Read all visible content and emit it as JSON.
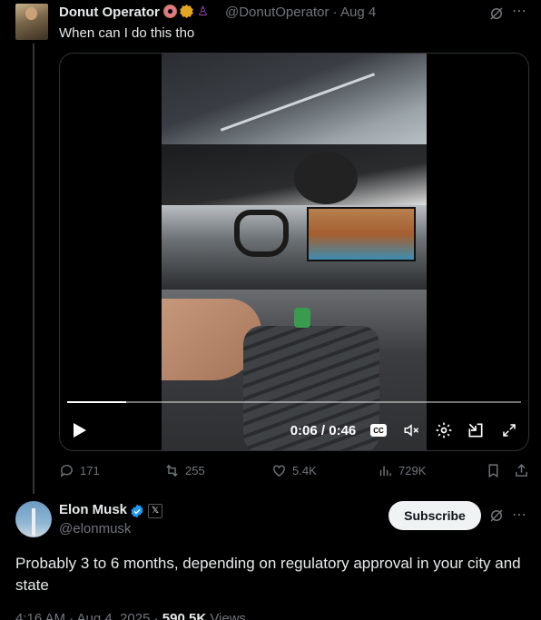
{
  "quoted_tweet": {
    "display_name": "Donut Operator",
    "badges": [
      "donut-emoji",
      "gold-verified-badge",
      "person-emoji"
    ],
    "handle": "@DonutOperator",
    "separator": "·",
    "date": "Aug 4",
    "text": "When can I do this tho",
    "video": {
      "current_time": "0:06",
      "duration": "0:46",
      "time_label": "0:06 / 0:46",
      "progress_fraction": 0.13,
      "cc_label": "CC"
    },
    "stats": {
      "replies": "171",
      "reposts": "255",
      "likes": "5.4K",
      "views": "729K"
    }
  },
  "reply": {
    "display_name": "Elon Musk",
    "x_badge": "𝕏",
    "handle": "@elonmusk",
    "subscribe_label": "Subscribe",
    "text": "Probably 3 to 6 months, depending on regulatory approval in your city and state",
    "time": "4:16 AM · Aug 4, 2025 ·",
    "views_count": "590.5K",
    "views_label": "Views"
  },
  "colors": {
    "background": "#000000",
    "text_primary": "#e7e9ea",
    "text_secondary": "#71767b",
    "verified_blue": "#1d9bf0",
    "subscribe_bg": "#eff3f4"
  }
}
